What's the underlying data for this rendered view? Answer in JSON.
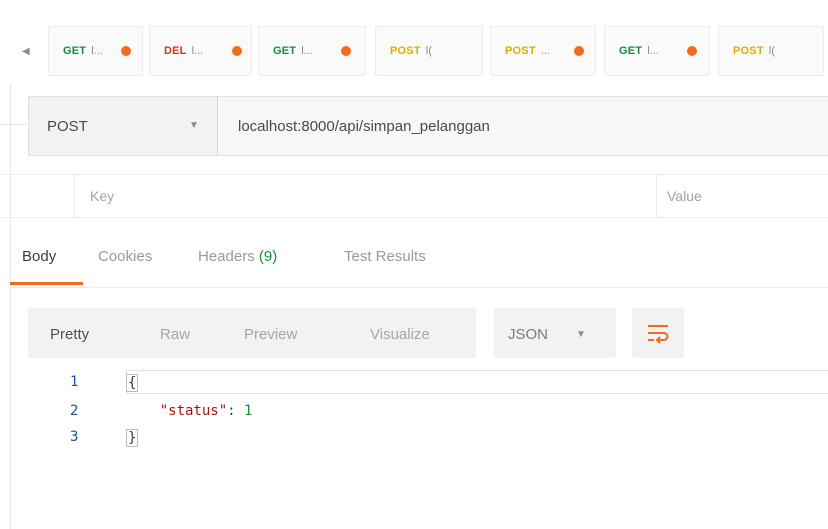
{
  "tabs": [
    {
      "method": "GET",
      "name": "l...",
      "method_color": "#1a8f36",
      "unsaved": true
    },
    {
      "method": "DEL",
      "name": "l...",
      "method_color": "#d9331c",
      "unsaved": true
    },
    {
      "method": "GET",
      "name": "l...",
      "method_color": "#1a8f36",
      "unsaved": true
    },
    {
      "method": "POST",
      "name": "l(",
      "method_color": "#e3ab00",
      "unsaved": false
    },
    {
      "method": "POST",
      "name": "...",
      "method_color": "#e3ab00",
      "unsaved": true
    },
    {
      "method": "GET",
      "name": "l...",
      "method_color": "#1a8f36",
      "unsaved": true
    },
    {
      "method": "POST",
      "name": "l(",
      "method_color": "#e3ab00",
      "unsaved": false
    }
  ],
  "request": {
    "method": "POST",
    "url": "localhost:8000/api/simpan_pelanggan"
  },
  "params": {
    "key_header": "Key",
    "value_header": "Value"
  },
  "response_tabs": {
    "body": "Body",
    "cookies": "Cookies",
    "headers": "Headers",
    "headers_count": "(9)",
    "test_results": "Test Results",
    "active": "Body"
  },
  "view": {
    "pretty": "Pretty",
    "raw": "Raw",
    "preview": "Preview",
    "visualize": "Visualize",
    "format": "JSON",
    "active": "Pretty"
  },
  "code": {
    "line_numbers": [
      "1",
      "2",
      "3"
    ],
    "open_brace": "{",
    "key": "\"status\"",
    "colon": ": ",
    "value": "1",
    "close_brace": "}"
  },
  "colors": {
    "accent": "#f26b1d",
    "get": "#1a8f36",
    "delete": "#d9331c",
    "post": "#e3ab00"
  },
  "icons": {
    "tab_scroll": "caret-left-icon",
    "unsaved": "unsaved-dot-icon",
    "dropdown": "chevron-down-icon",
    "wrap": "wrap-lines-icon"
  }
}
